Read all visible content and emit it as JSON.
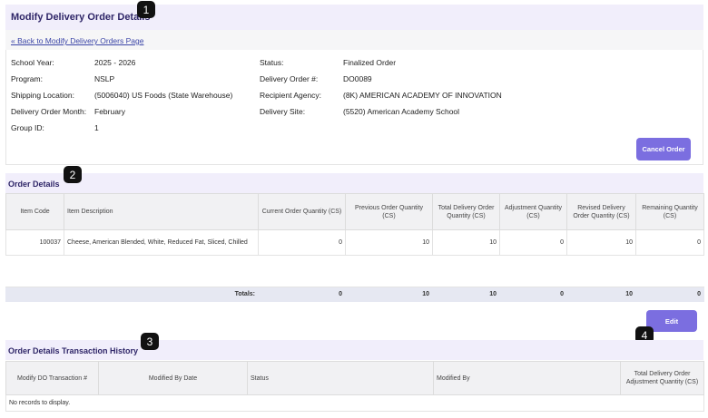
{
  "page": {
    "title": "Modify Delivery Order Details",
    "back_link": "« Back to Modify Delivery Orders Page"
  },
  "info": {
    "left": [
      {
        "label": "School Year:",
        "value": "2025 - 2026"
      },
      {
        "label": "Program:",
        "value": "NSLP"
      },
      {
        "label": "Shipping Location:",
        "value": "(5006040) US Foods (State Warehouse)"
      },
      {
        "label": "Delivery Order Month:",
        "value": "February"
      },
      {
        "label": "Group ID:",
        "value": "1"
      }
    ],
    "right": [
      {
        "label": "Status:",
        "value": "Finalized Order"
      },
      {
        "label": "Delivery Order #:",
        "value": "DO0089"
      },
      {
        "label": "Recipient Agency:",
        "value": "(8K) AMERICAN ACADEMY OF INNOVATION"
      },
      {
        "label": "Delivery Site:",
        "value": "(5520) American Academy School"
      }
    ],
    "cancel_button": "Cancel Order"
  },
  "order_details": {
    "title": "Order Details",
    "columns": [
      "Item Code",
      "Item Description",
      "Current Order Quantity (CS)",
      "Previous Order Quantity (CS)",
      "Total Delivery Order Quantity (CS)",
      "Adjustment Quantity (CS)",
      "Revised Delivery Order Quantity (CS)",
      "Remaining Quantity (CS)"
    ],
    "rows": [
      {
        "code": "100037",
        "desc": "Cheese, American Blended, White, Reduced Fat, Sliced, Chilled",
        "current": "0",
        "previous": "10",
        "total": "10",
        "adjustment": "0",
        "revised": "10",
        "remaining": "0"
      }
    ],
    "totals": {
      "label": "Totals:",
      "current": "0",
      "previous": "10",
      "total": "10",
      "adjustment": "0",
      "revised": "10",
      "remaining": "0"
    },
    "edit_button": "Edit"
  },
  "history": {
    "title": "Order Details Transaction History",
    "columns": [
      "Modify DO Transaction #",
      "Modified By Date",
      "Status",
      "Modified By",
      "Total Delivery Order Adjustment Quantity (CS)"
    ],
    "empty": "No records to display."
  },
  "badges": [
    "1",
    "2",
    "3",
    "4"
  ]
}
